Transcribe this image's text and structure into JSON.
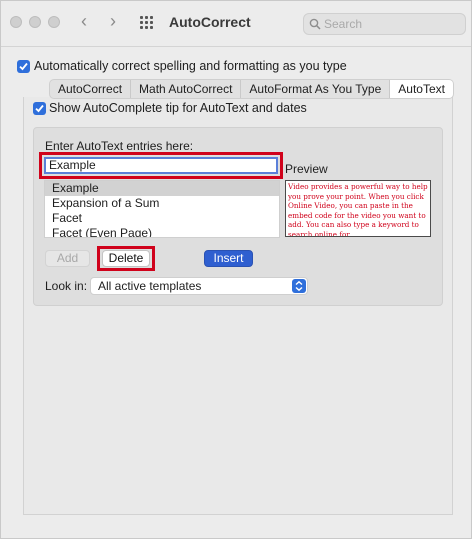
{
  "window": {
    "title": "AutoCorrect",
    "search_placeholder": "Search"
  },
  "main": {
    "auto_correct_label": "Automatically correct spelling and formatting as you type",
    "tabs": [
      {
        "label": "AutoCorrect",
        "active": false
      },
      {
        "label": "Math AutoCorrect",
        "active": false
      },
      {
        "label": "AutoFormat As You Type",
        "active": false
      },
      {
        "label": "AutoText",
        "active": true
      }
    ],
    "show_tip_label": "Show AutoComplete tip for AutoText and dates",
    "enter_label": "Enter AutoText entries here:",
    "entry_value": "Example",
    "preview_label": "Preview",
    "list_items": [
      "Example",
      "Expansion of a Sum",
      "Facet",
      "Facet (Even Page)"
    ],
    "selected_item": "Example",
    "preview_text": "Video provides a powerful way to help you prove your point. When you click Online Video, you can paste in the embed code for the video you want to add. You can also type a keyword to search online for",
    "buttons": {
      "add": "Add",
      "delete": "Delete",
      "insert": "Insert"
    },
    "look_in_label": "Look in:",
    "look_in_value": "All active templates"
  },
  "colors": {
    "accent": "#2f6fdb",
    "highlight_box": "#d0021b",
    "preview_text": "#d0021b"
  },
  "icons": [
    "close-light",
    "minimize-light",
    "zoom-light",
    "back-chevron-icon",
    "forward-chevron-icon",
    "grid-icon",
    "search-icon",
    "checkmark-icon",
    "popup-stepper-icon"
  ]
}
